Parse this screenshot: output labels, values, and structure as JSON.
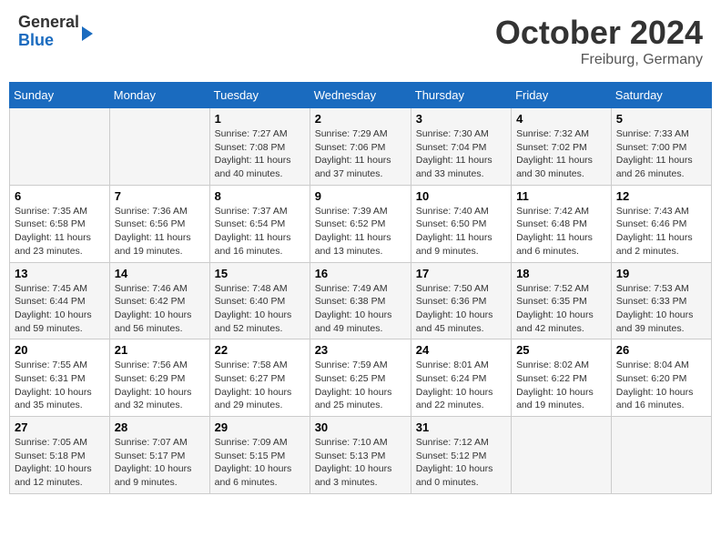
{
  "header": {
    "logo_general": "General",
    "logo_blue": "Blue",
    "title": "October 2024",
    "subtitle": "Freiburg, Germany"
  },
  "calendar": {
    "days_of_week": [
      "Sunday",
      "Monday",
      "Tuesday",
      "Wednesday",
      "Thursday",
      "Friday",
      "Saturday"
    ],
    "weeks": [
      [
        {
          "day": "",
          "info": ""
        },
        {
          "day": "",
          "info": ""
        },
        {
          "day": "1",
          "info": "Sunrise: 7:27 AM\nSunset: 7:08 PM\nDaylight: 11 hours and 40 minutes."
        },
        {
          "day": "2",
          "info": "Sunrise: 7:29 AM\nSunset: 7:06 PM\nDaylight: 11 hours and 37 minutes."
        },
        {
          "day": "3",
          "info": "Sunrise: 7:30 AM\nSunset: 7:04 PM\nDaylight: 11 hours and 33 minutes."
        },
        {
          "day": "4",
          "info": "Sunrise: 7:32 AM\nSunset: 7:02 PM\nDaylight: 11 hours and 30 minutes."
        },
        {
          "day": "5",
          "info": "Sunrise: 7:33 AM\nSunset: 7:00 PM\nDaylight: 11 hours and 26 minutes."
        }
      ],
      [
        {
          "day": "6",
          "info": "Sunrise: 7:35 AM\nSunset: 6:58 PM\nDaylight: 11 hours and 23 minutes."
        },
        {
          "day": "7",
          "info": "Sunrise: 7:36 AM\nSunset: 6:56 PM\nDaylight: 11 hours and 19 minutes."
        },
        {
          "day": "8",
          "info": "Sunrise: 7:37 AM\nSunset: 6:54 PM\nDaylight: 11 hours and 16 minutes."
        },
        {
          "day": "9",
          "info": "Sunrise: 7:39 AM\nSunset: 6:52 PM\nDaylight: 11 hours and 13 minutes."
        },
        {
          "day": "10",
          "info": "Sunrise: 7:40 AM\nSunset: 6:50 PM\nDaylight: 11 hours and 9 minutes."
        },
        {
          "day": "11",
          "info": "Sunrise: 7:42 AM\nSunset: 6:48 PM\nDaylight: 11 hours and 6 minutes."
        },
        {
          "day": "12",
          "info": "Sunrise: 7:43 AM\nSunset: 6:46 PM\nDaylight: 11 hours and 2 minutes."
        }
      ],
      [
        {
          "day": "13",
          "info": "Sunrise: 7:45 AM\nSunset: 6:44 PM\nDaylight: 10 hours and 59 minutes."
        },
        {
          "day": "14",
          "info": "Sunrise: 7:46 AM\nSunset: 6:42 PM\nDaylight: 10 hours and 56 minutes."
        },
        {
          "day": "15",
          "info": "Sunrise: 7:48 AM\nSunset: 6:40 PM\nDaylight: 10 hours and 52 minutes."
        },
        {
          "day": "16",
          "info": "Sunrise: 7:49 AM\nSunset: 6:38 PM\nDaylight: 10 hours and 49 minutes."
        },
        {
          "day": "17",
          "info": "Sunrise: 7:50 AM\nSunset: 6:36 PM\nDaylight: 10 hours and 45 minutes."
        },
        {
          "day": "18",
          "info": "Sunrise: 7:52 AM\nSunset: 6:35 PM\nDaylight: 10 hours and 42 minutes."
        },
        {
          "day": "19",
          "info": "Sunrise: 7:53 AM\nSunset: 6:33 PM\nDaylight: 10 hours and 39 minutes."
        }
      ],
      [
        {
          "day": "20",
          "info": "Sunrise: 7:55 AM\nSunset: 6:31 PM\nDaylight: 10 hours and 35 minutes."
        },
        {
          "day": "21",
          "info": "Sunrise: 7:56 AM\nSunset: 6:29 PM\nDaylight: 10 hours and 32 minutes."
        },
        {
          "day": "22",
          "info": "Sunrise: 7:58 AM\nSunset: 6:27 PM\nDaylight: 10 hours and 29 minutes."
        },
        {
          "day": "23",
          "info": "Sunrise: 7:59 AM\nSunset: 6:25 PM\nDaylight: 10 hours and 25 minutes."
        },
        {
          "day": "24",
          "info": "Sunrise: 8:01 AM\nSunset: 6:24 PM\nDaylight: 10 hours and 22 minutes."
        },
        {
          "day": "25",
          "info": "Sunrise: 8:02 AM\nSunset: 6:22 PM\nDaylight: 10 hours and 19 minutes."
        },
        {
          "day": "26",
          "info": "Sunrise: 8:04 AM\nSunset: 6:20 PM\nDaylight: 10 hours and 16 minutes."
        }
      ],
      [
        {
          "day": "27",
          "info": "Sunrise: 7:05 AM\nSunset: 5:18 PM\nDaylight: 10 hours and 12 minutes."
        },
        {
          "day": "28",
          "info": "Sunrise: 7:07 AM\nSunset: 5:17 PM\nDaylight: 10 hours and 9 minutes."
        },
        {
          "day": "29",
          "info": "Sunrise: 7:09 AM\nSunset: 5:15 PM\nDaylight: 10 hours and 6 minutes."
        },
        {
          "day": "30",
          "info": "Sunrise: 7:10 AM\nSunset: 5:13 PM\nDaylight: 10 hours and 3 minutes."
        },
        {
          "day": "31",
          "info": "Sunrise: 7:12 AM\nSunset: 5:12 PM\nDaylight: 10 hours and 0 minutes."
        },
        {
          "day": "",
          "info": ""
        },
        {
          "day": "",
          "info": ""
        }
      ]
    ]
  }
}
